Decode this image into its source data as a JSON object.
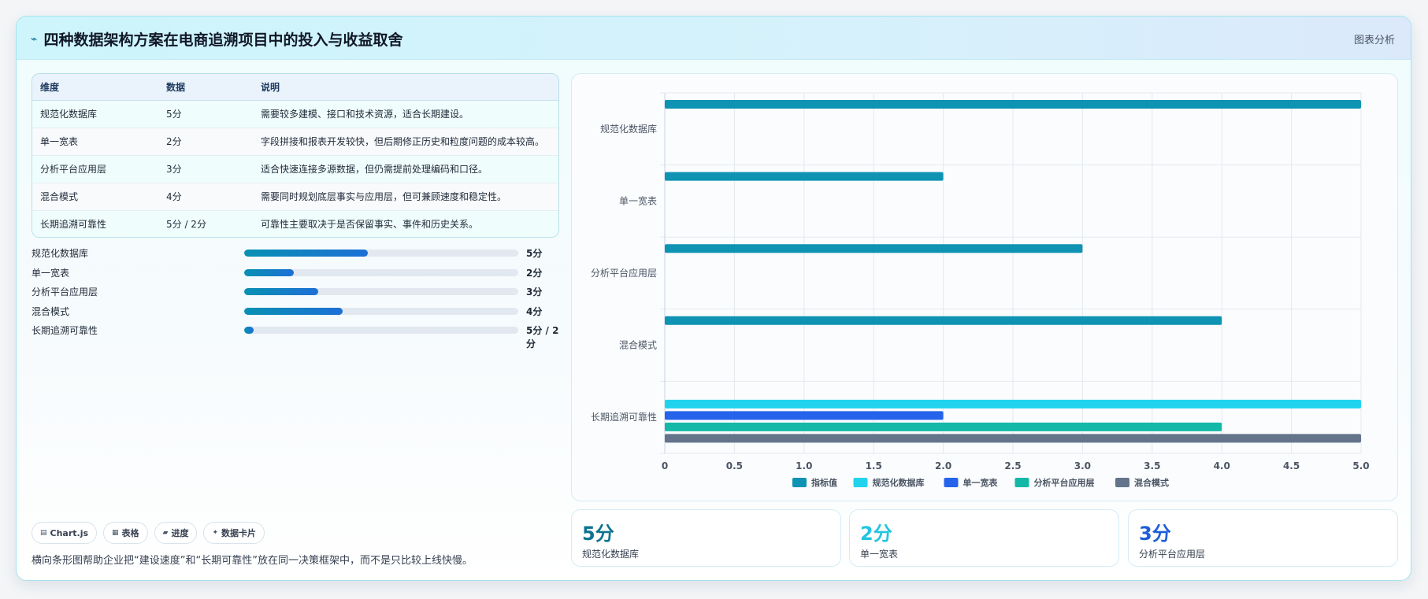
{
  "header": {
    "title": "四种数据架构方案在电商追溯项目中的投入与收益取舍",
    "action": "图表分析",
    "title_icon": "trend-line-icon"
  },
  "table": {
    "columns": [
      "维度",
      "数据",
      "说明"
    ],
    "rows": [
      [
        "规范化数据库",
        "5分",
        "需要较多建模、接口和技术资源，适合长期建设。"
      ],
      [
        "单一宽表",
        "2分",
        "字段拼接和报表开发较快，但后期修正历史和粒度问题的成本较高。"
      ],
      [
        "分析平台应用层",
        "3分",
        "适合快速连接多源数据，但仍需提前处理编码和口径。"
      ],
      [
        "混合模式",
        "4分",
        "需要同时规划底层事实与应用层，但可兼顾速度和稳定性。"
      ],
      [
        "长期追溯可靠性",
        "5分 / 2分",
        "可靠性主要取决于是否保留事实、事件和历史关系。"
      ]
    ]
  },
  "progress": [
    {
      "label": "规范化数据库",
      "value": "5分",
      "fraction": 0.45
    },
    {
      "label": "单一宽表",
      "value": "2分",
      "fraction": 0.18
    },
    {
      "label": "分析平台应用层",
      "value": "3分",
      "fraction": 0.27
    },
    {
      "label": "混合模式",
      "value": "4分",
      "fraction": 0.36
    },
    {
      "label": "长期追溯可靠性",
      "value": "5分 / 2分",
      "fraction": 0.035
    }
  ],
  "chips": [
    {
      "icon": "chart-icon",
      "label": "Chart.js"
    },
    {
      "icon": "table-icon",
      "label": "表格"
    },
    {
      "icon": "progress-icon",
      "label": "进度"
    },
    {
      "icon": "sparkle-icon",
      "label": "数据卡片"
    }
  ],
  "caption": "横向条形图帮助企业把“建设速度”和“长期可靠性”放在同一决策框架中，而不是只比较上线快慢。",
  "stats": [
    {
      "value": "5分",
      "label": "规范化数据库",
      "color": "#0e7490"
    },
    {
      "value": "2分",
      "label": "单一宽表",
      "color": "#22c5e0"
    },
    {
      "value": "3分",
      "label": "分析平台应用层",
      "color": "#1d5ed8"
    }
  ],
  "chart_data": {
    "type": "bar",
    "orientation": "horizontal",
    "categories": [
      "规范化数据库",
      "单一宽表",
      "分析平台应用层",
      "混合模式",
      "长期追溯可靠性"
    ],
    "series": [
      {
        "name": "指标值",
        "color": "#0e93b3",
        "values": [
          5,
          2,
          3,
          4,
          null
        ]
      },
      {
        "name": "规范化数据库",
        "color": "#22d3ee",
        "values": [
          null,
          null,
          null,
          null,
          5
        ]
      },
      {
        "name": "单一宽表",
        "color": "#2563eb",
        "values": [
          null,
          null,
          null,
          null,
          2
        ]
      },
      {
        "name": "分析平台应用层",
        "color": "#14b8a6",
        "values": [
          null,
          null,
          null,
          null,
          4
        ]
      },
      {
        "name": "混合模式",
        "color": "#64748b",
        "values": [
          null,
          null,
          null,
          null,
          5
        ]
      }
    ],
    "xticks": [
      "0",
      "0.5",
      "1.0",
      "1.5",
      "2.0",
      "2.5",
      "3.0",
      "3.5",
      "4.0",
      "4.5",
      "5.0"
    ],
    "xlim": [
      0,
      5
    ],
    "grid": true,
    "legend": "bottom"
  }
}
